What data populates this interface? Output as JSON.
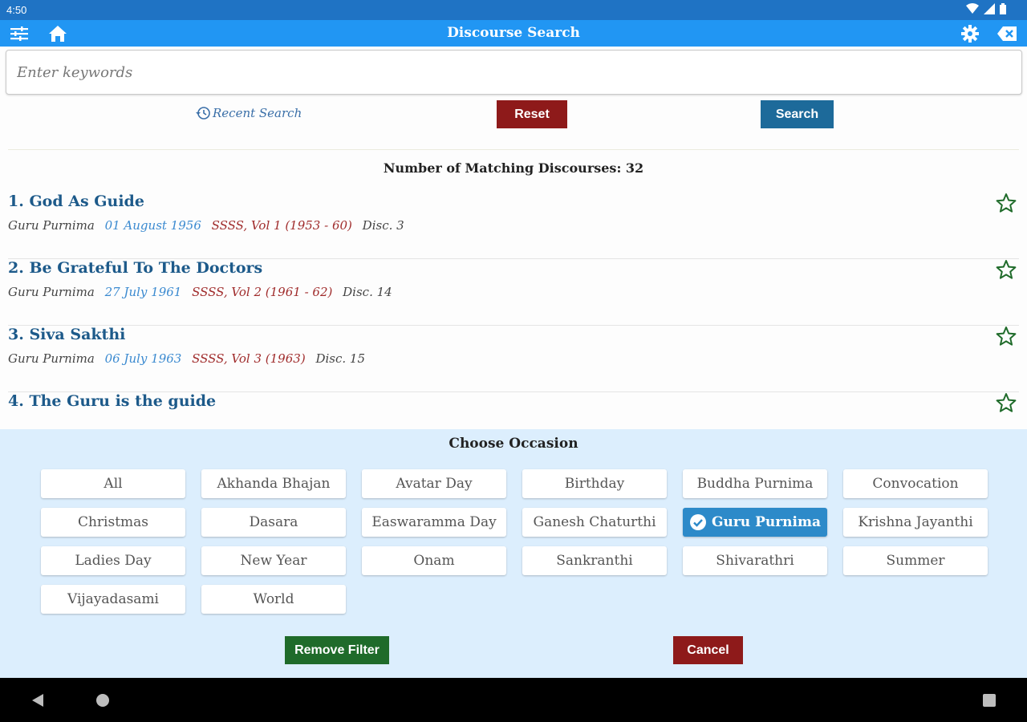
{
  "status": {
    "time": "4:50"
  },
  "app_bar": {
    "title": "Discourse Search"
  },
  "search": {
    "placeholder": "Enter keywords",
    "value": ""
  },
  "controls": {
    "recent_label": "Recent Search",
    "reset_label": "Reset",
    "search_label": "Search"
  },
  "results": {
    "count_text": "Number of Matching Discourses: 32",
    "items": [
      {
        "title": "1. God As Guide",
        "occasion": "Guru Purnima",
        "date": "01 August 1956",
        "volume": "SSSS, Vol 1 (1953 - 60)",
        "disc": "Disc. 3"
      },
      {
        "title": "2. Be Grateful To The Doctors",
        "occasion": "Guru Purnima",
        "date": "27 July 1961",
        "volume": "SSSS, Vol 2 (1961 - 62)",
        "disc": "Disc. 14"
      },
      {
        "title": "3. Siva Sakthi",
        "occasion": "Guru Purnima",
        "date": "06 July 1963",
        "volume": "SSSS, Vol 3 (1963)",
        "disc": "Disc. 15"
      },
      {
        "title": "4. The Guru is the guide"
      }
    ]
  },
  "occasion_panel": {
    "title": "Choose Occasion",
    "options": [
      "All",
      "Akhanda Bhajan",
      "Avatar Day",
      "Birthday",
      "Buddha Purnima",
      "Convocation",
      "Christmas",
      "Dasara",
      "Easwaramma Day",
      "Ganesh Chaturthi",
      "Guru Purnima",
      "Krishna Jayanthi",
      "Ladies Day",
      "New Year",
      "Onam",
      "Sankranthi",
      "Shivarathri",
      "Summer",
      "Vijayadasami",
      "World"
    ],
    "selected": "Guru Purnima",
    "remove_filter_label": "Remove Filter",
    "cancel_label": "Cancel"
  },
  "colors": {
    "app_bar": "#2196f3",
    "status_bar": "#1f73c4",
    "reset": "#8e1a1a",
    "search": "#1d6a9a",
    "remove_filter": "#1f6b2a",
    "panel": "#dceefd",
    "selected_chip": "#2d8ac9",
    "star": "#1f6b2a"
  }
}
